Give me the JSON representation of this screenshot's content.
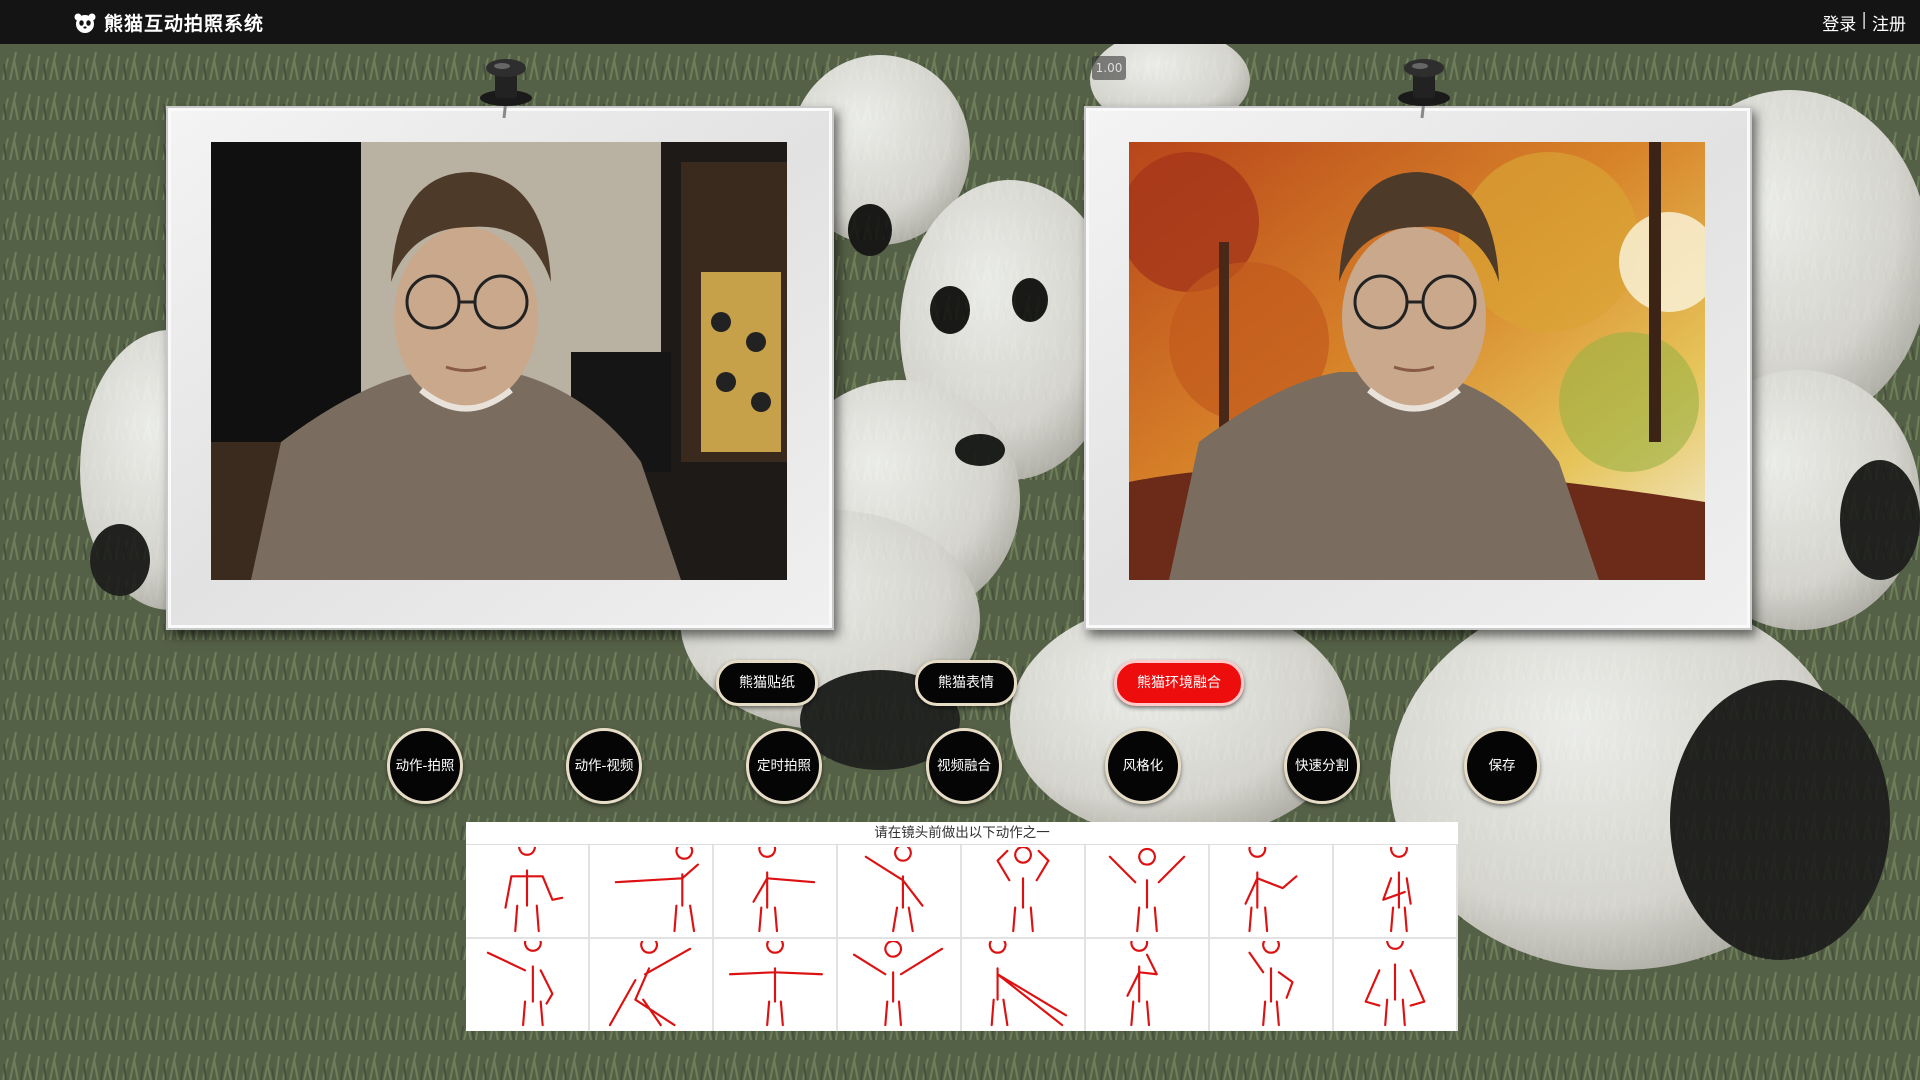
{
  "app": {
    "title": "熊猫互动拍照系统"
  },
  "auth": {
    "login": "登录",
    "separator": "|",
    "register": "注册"
  },
  "preview": {
    "zoom": "1.00"
  },
  "frames": {
    "left": {
      "content": "camera-feed"
    },
    "right": {
      "content": "composited-output"
    }
  },
  "features": [
    {
      "label": "熊猫贴纸",
      "active": false
    },
    {
      "label": "熊猫表情",
      "active": false
    },
    {
      "label": "熊猫环境融合",
      "active": true
    }
  ],
  "actions": [
    {
      "label": "动作-拍照"
    },
    {
      "label": "动作-视频"
    },
    {
      "label": "定时拍照"
    },
    {
      "label": "视频融合"
    },
    {
      "label": "风格化"
    },
    {
      "label": "快速分割"
    },
    {
      "label": "保存"
    }
  ],
  "poses": {
    "prompt": "请在镜头前做出以下动作之一",
    "count": 16
  },
  "colors": {
    "topbar": "#141414",
    "button_bg": "#050505",
    "button_active": "#ee0d0d",
    "pose_stroke": "#dd1111"
  }
}
